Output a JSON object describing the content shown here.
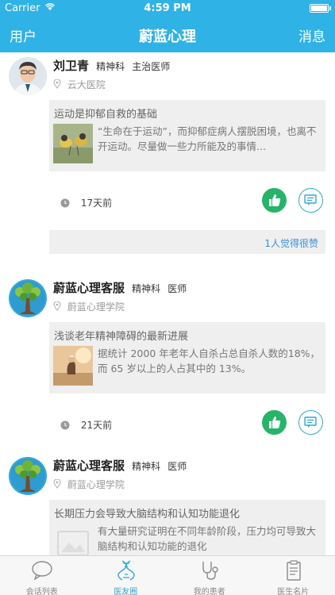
{
  "status_bar": {
    "carrier": "Carrier",
    "time": "4:59 PM"
  },
  "nav": {
    "left": "用户",
    "title": "蔚蓝心理",
    "right": "消息"
  },
  "posts": [
    {
      "name": "刘卫青",
      "department": "精神科",
      "title": "主治医师",
      "hospital": "云大医院",
      "article_title": "运动是抑郁自救的基础",
      "snippet": "“生命在于运动”，而抑郁症病人摆脱困境，也离不开运动。尽量做一些力所能及的事情...",
      "time": "17天前",
      "likes": "1人觉得很赞"
    },
    {
      "name": "蔚蓝心理客服",
      "department": "精神科",
      "title": "医师",
      "hospital": "蔚蓝心理学院",
      "article_title": "浅谈老年精神障碍的最新进展",
      "snippet": "据统计 2000 年老年人自杀占总自杀人数的18%，而 65 岁以上的人占其中的 13%。",
      "time": "21天前"
    },
    {
      "name": "蔚蓝心理客服",
      "department": "精神科",
      "title": "医师",
      "hospital": "蔚蓝心理学院",
      "article_title": "长期压力会导致大脑结构和认知功能退化",
      "snippet": "有大量研究证明在不同年龄阶段，压力均可导致大脑结构和认知功能的退化"
    }
  ],
  "tabs": [
    {
      "label": "会话列表",
      "icon": "chat-bubble-icon"
    },
    {
      "label": "医友圈",
      "icon": "dna-icon"
    },
    {
      "label": "我的患者",
      "icon": "stethoscope-icon"
    },
    {
      "label": "医生名片",
      "icon": "clipboard-icon"
    }
  ],
  "colors": {
    "brand": "#2fb2e6",
    "like": "#26b468",
    "link": "#3a8fd4"
  }
}
